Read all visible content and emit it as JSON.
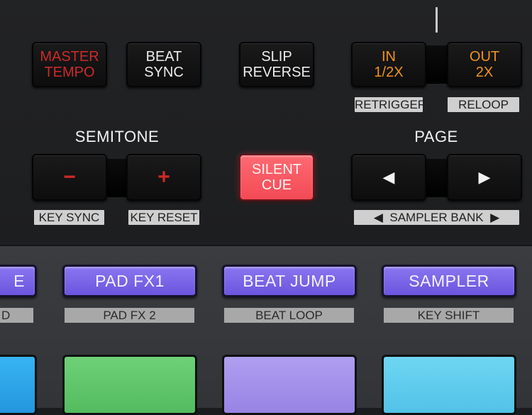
{
  "top_section": {
    "buttons": {
      "master_tempo": {
        "line1": "MASTER",
        "line2": "TEMPO"
      },
      "beat_sync": {
        "line1": "BEAT",
        "line2": "SYNC"
      },
      "slip_reverse": {
        "line1": "SLIP",
        "line2": "REVERSE"
      },
      "in": {
        "line1": "IN",
        "line2": "1/2X"
      },
      "out": {
        "line1": "OUT",
        "line2": "2X"
      },
      "semitone_minus": "−",
      "semitone_plus": "+",
      "silent_cue": {
        "line1": "SILENT",
        "line2": "CUE"
      },
      "page_prev": "◀",
      "page_next": "▶"
    },
    "titles": {
      "semitone": "SEMITONE",
      "page": "PAGE"
    },
    "labels": {
      "retrigger": "RETRIGGER",
      "reloop": "RELOOP",
      "key_sync": "KEY SYNC",
      "key_reset": "KEY RESET",
      "sampler_bank": "◀  SAMPLER BANK  ▶"
    }
  },
  "pad_modes": [
    {
      "label": "E",
      "secondary": "D"
    },
    {
      "label": "PAD FX1",
      "secondary": "PAD FX 2"
    },
    {
      "label": "BEAT JUMP",
      "secondary": "BEAT LOOP"
    },
    {
      "label": "SAMPLER",
      "secondary": "KEY SHIFT"
    }
  ],
  "colors": {
    "master_tempo_red": "#cc2a2a",
    "loop_orange": "#f0921c",
    "silent_cue_red": "#f24a55",
    "mode_purple": "#7a65e8",
    "pad_colors": [
      "#2da6ea",
      "#5dc468",
      "#9f8ce8",
      "#5cc9ec"
    ]
  }
}
